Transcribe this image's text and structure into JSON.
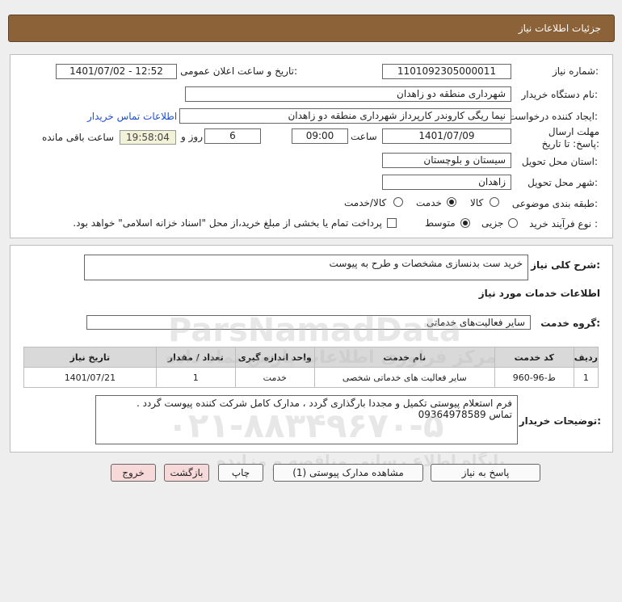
{
  "header": {
    "title": "جزئیات اطلاعات نیاز"
  },
  "form": {
    "need_number_label": "شماره نیاز:",
    "need_number": "1101092305000011",
    "announce_label": "تاریخ و ساعت اعلان عمومی:",
    "announce_value": "1401/07/02 - 12:52",
    "buyer_org_label": "نام دستگاه خریدار:",
    "buyer_org": "شهرداری منطقه دو زاهدان",
    "creator_label": "ایجاد کننده درخواست:",
    "creator": "نیما ریگی کاروندر کارپرداز شهرداری منطقه دو زاهدان",
    "contact_link": "اطلاعات تماس خریدار",
    "deadline_label": "مهلت ارسال پاسخ: تا تاریخ:",
    "deadline_date": "1401/07/09",
    "time_label": "ساعت",
    "deadline_time": "09:00",
    "days_value": "6",
    "days_label": "روز و",
    "remaining_time": "19:58:04",
    "remaining_label": "ساعت باقی مانده",
    "province_label": "استان محل تحویل:",
    "province": "سیستان و بلوچستان",
    "city_label": "شهر محل تحویل:",
    "city": "زاهدان",
    "category_label": "طبقه بندی موضوعی:",
    "category_options": [
      "کالا",
      "خدمت",
      "کالا/خدمت"
    ],
    "category_selected": "خدمت",
    "purchase_type_label": "نوع فرآیند خرید :",
    "purchase_options": [
      "جزیی",
      "متوسط"
    ],
    "purchase_selected": "متوسط",
    "payment_note": "پرداخت تمام یا بخشی از مبلغ خرید،از محل \"اسناد خزانه اسلامی\" خواهد بود."
  },
  "details": {
    "summary_label": "شرح کلی نیاز:",
    "summary": "خرید ست بدنسازی مشخصات و طرح به پیوست",
    "services_title": "اطلاعات خدمات مورد نیاز",
    "service_group_label": "گروه خدمت:",
    "service_group": "سایر فعالیت‌های خدماتی",
    "table": {
      "headers": [
        "ردیف",
        "کد خدمت",
        "نام خدمت",
        "واحد اندازه گیری",
        "تعداد / مقدار",
        "تاریخ نیاز"
      ],
      "rows": [
        [
          "1",
          "ط-96-960",
          "سایر فعالیت های خدماتی شخصی",
          "خدمت",
          "1",
          "1401/07/21"
        ]
      ]
    },
    "buyer_notes_label": "توضیحات خریدار:",
    "buyer_notes_line1": "فرم استعلام پیوستی تکمیل و مجددا بارگذاری گردد ، مدارک کامل شرکت کننده پیوست گردد .",
    "buyer_notes_line2": "تماس 09364978589"
  },
  "buttons": {
    "respond": "پاسخ به نیاز",
    "view_docs": "مشاهده مدارک پیوستی (1)",
    "print": "چاپ",
    "back": "بازگشت",
    "exit": "خروج"
  },
  "watermark": {
    "brand": "ParsNamadData",
    "phone": "۰۲۱-۸۸۳۴۹۶۷۰-۵",
    "tagline": "مرکز فراوری اطلاعات پارس نماد داده",
    "tagline2": "پایگاه اطلاع رسانی مناقصه و مزایده"
  }
}
